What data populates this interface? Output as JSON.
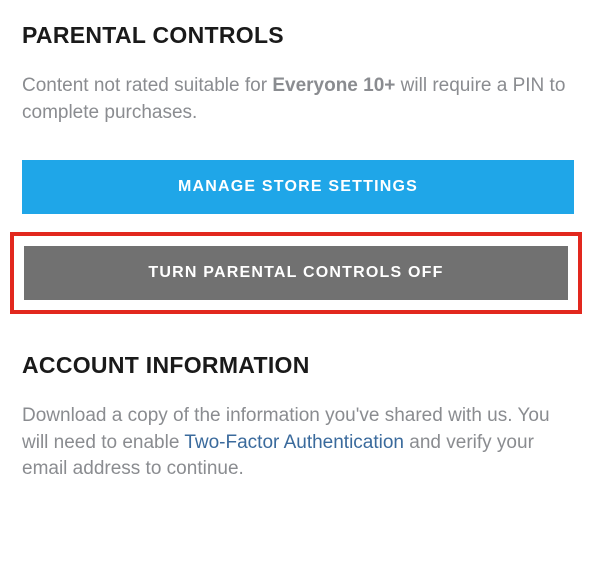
{
  "parental": {
    "heading": "PARENTAL CONTROLS",
    "desc_prefix": "Content not rated suitable for ",
    "desc_bold": "Everyone 10+",
    "desc_suffix": " will require a PIN to complete purchases.",
    "manage_button": "MANAGE STORE SETTINGS",
    "turn_off_button": "TURN PARENTAL CONTROLS OFF"
  },
  "account": {
    "heading": "ACCOUNT INFORMATION",
    "desc_prefix": "Download a copy of the information you've shared with us. You will need to enable ",
    "link_text": "Two-Factor Authentication",
    "desc_suffix": " and verify your email address to continue."
  }
}
